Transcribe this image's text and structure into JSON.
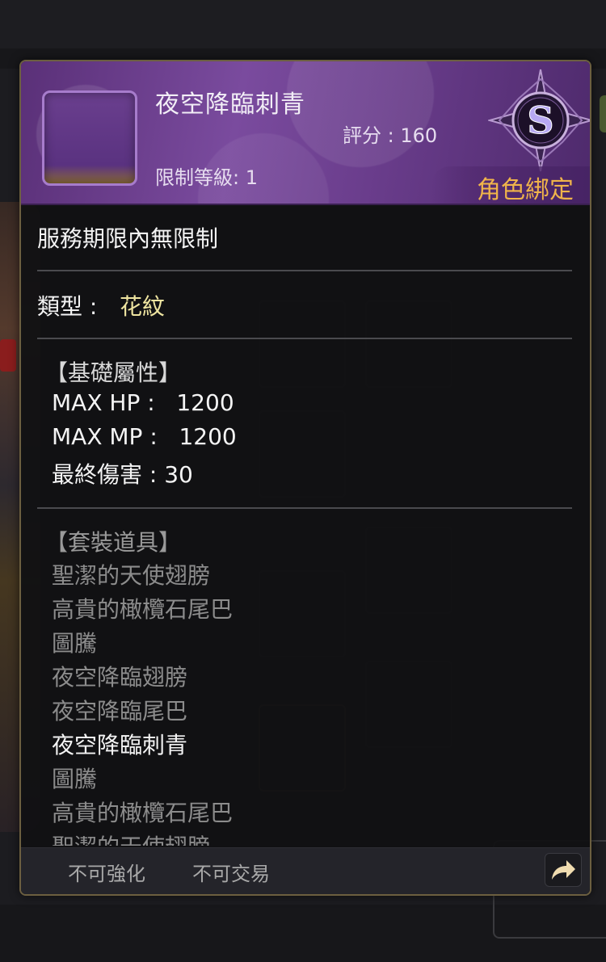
{
  "item": {
    "name": "夜空降臨刺青",
    "score": "評分 : 160",
    "level_req": "限制等級: 1",
    "rank": "S",
    "binding": "角色綁定",
    "service_period": "服務期限內無限制",
    "type_label": "類型 :",
    "type_value": "花紋"
  },
  "base_attributes": {
    "header": "【基礎屬性】",
    "rows": [
      "MAX HP :   1200",
      "MAX MP :   1200",
      "最終傷害 : 30"
    ]
  },
  "set_items": {
    "header": "【套裝道具】",
    "items": [
      {
        "name": "聖潔的天使翅膀",
        "current": false
      },
      {
        "name": "高貴的橄欖石尾巴",
        "current": false
      },
      {
        "name": "圖騰",
        "current": false
      },
      {
        "name": "夜空降臨翅膀",
        "current": false
      },
      {
        "name": "夜空降臨尾巴",
        "current": false
      },
      {
        "name": "夜空降臨刺青",
        "current": true
      },
      {
        "name": "圖騰",
        "current": false
      },
      {
        "name": "高貴的橄欖石尾巴",
        "current": false
      },
      {
        "name": "聖潔的天使翅膀",
        "current": false
      }
    ]
  },
  "footer": {
    "no_enhance": "不可強化",
    "no_trade": "不可交易"
  },
  "colors": {
    "header_purple": "#6a3d8c",
    "bind_orange": "#f0b44a",
    "type_yellow": "#eee4a0",
    "border_gold": "#6c5f40"
  },
  "icons": {
    "rank": "s-rank-emblem-icon",
    "share": "share-arrow-icon"
  }
}
